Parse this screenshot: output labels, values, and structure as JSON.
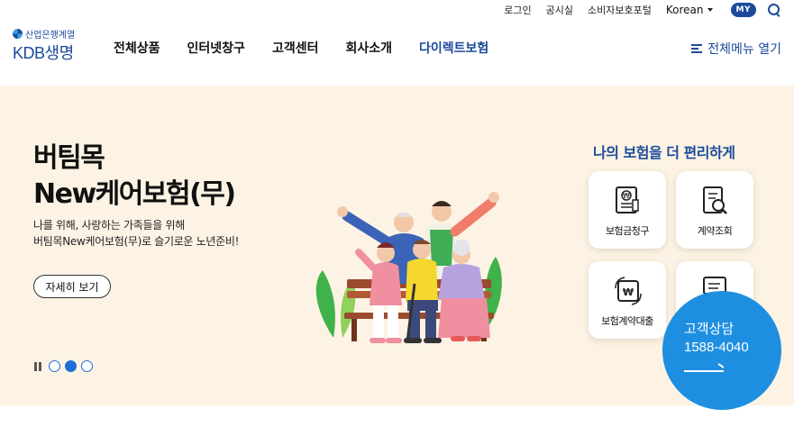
{
  "util": {
    "login": "로그인",
    "notice": "공시실",
    "consumer_portal": "소비자보호포털",
    "language": "Korean",
    "my": "MY"
  },
  "logo": {
    "subtitle": "산업은행계열",
    "name": "KDB생명"
  },
  "gnb": {
    "items": [
      "전체상품",
      "인터넷창구",
      "고객센터",
      "회사소개",
      "다이렉트보험"
    ]
  },
  "allmenu": {
    "label": "전체메뉴 열기"
  },
  "hero": {
    "title_line1": "버팀목",
    "title_line2": "New케어보험(무)",
    "desc_line1": "나를 위해, 사랑하는 가족들을 위해",
    "desc_line2": "버팀목New케어보험(무)로 슬기로운 노년준비!",
    "detail_button": "자세히 보기",
    "slides_total": 3,
    "slide_active": 2
  },
  "quick": {
    "title": "나의 보험을 더 편리하게",
    "items": [
      {
        "label": "보험금청구",
        "icon": "claim-document-icon"
      },
      {
        "label": "계약조회",
        "icon": "contract-search-icon"
      },
      {
        "label": "보험계약대출",
        "icon": "loan-icon"
      },
      {
        "label": "",
        "icon": "document-icon"
      }
    ]
  },
  "customer_service": {
    "label": "고객상담",
    "phone": "1588-4040"
  },
  "colors": {
    "brand": "#1b4a9c",
    "hero_bg": "#fdf3e4",
    "cs_bg": "#1e8fe0"
  }
}
